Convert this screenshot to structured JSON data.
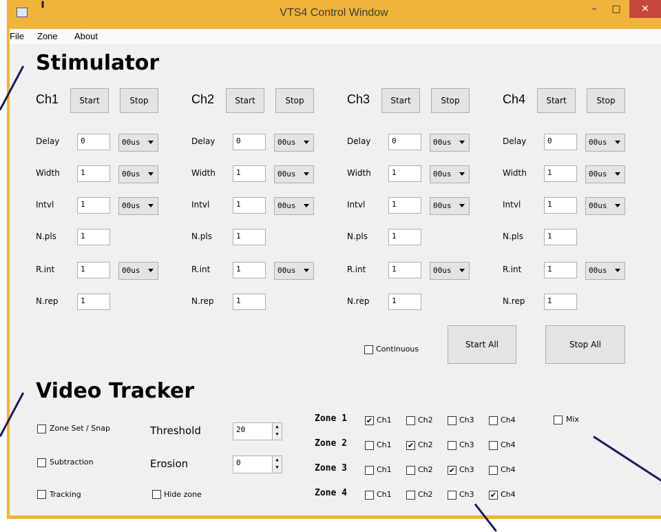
{
  "window": {
    "title": "VTS4 Control Window",
    "controls": {
      "minimize": "–",
      "maximize": "□",
      "close": "✕"
    },
    "accent": "#f0b43c"
  },
  "menu": [
    "File",
    "Zone",
    "About"
  ],
  "stimulator": {
    "heading": "Stimulator",
    "channels": [
      {
        "name": "Ch1",
        "start": "Start",
        "stop": "Stop",
        "labels": [
          "Delay",
          "Width",
          "Intvl",
          "N.pls",
          "R.int",
          "N.rep"
        ],
        "values": {
          "delay": "0",
          "width": "1",
          "intvl": "1",
          "npls": "1",
          "rint": "1",
          "nrep": "1"
        },
        "units": {
          "delay": "00us",
          "width": "00us",
          "intvl": "00us",
          "rint": "00us"
        }
      },
      {
        "name": "Ch2",
        "start": "Start",
        "stop": "Stop",
        "labels": [
          "Delay",
          "Width",
          "Intvl",
          "N.pls",
          "R.int",
          "N.rep"
        ],
        "values": {
          "delay": "0",
          "width": "1",
          "intvl": "1",
          "npls": "1",
          "rint": "1",
          "nrep": "1"
        },
        "units": {
          "delay": "00us",
          "width": "00us",
          "intvl": "00us",
          "rint": "00us"
        }
      },
      {
        "name": "Ch3",
        "start": "Start",
        "stop": "Stop",
        "labels": [
          "Delay",
          "Width",
          "Intvl",
          "N.pls",
          "R.int",
          "N.rep"
        ],
        "values": {
          "delay": "0",
          "width": "1",
          "intvl": "1",
          "npls": "1",
          "rint": "1",
          "nrep": "1"
        },
        "units": {
          "delay": "00us",
          "width": "00us",
          "intvl": "00us",
          "rint": "00us"
        }
      },
      {
        "name": "Ch4",
        "start": "Start",
        "stop": "Stop",
        "labels": [
          "Delay",
          "Width",
          "Intvl",
          "N.pls",
          "R.int",
          "N.rep"
        ],
        "values": {
          "delay": "0",
          "width": "1",
          "intvl": "1",
          "npls": "1",
          "rint": "1",
          "nrep": "1"
        },
        "units": {
          "delay": "00us",
          "width": "00us",
          "intvl": "00us",
          "rint": "00us"
        }
      }
    ],
    "continuous_label": "Continuous",
    "continuous_checked": false,
    "start_all": "Start All",
    "stop_all": "Stop All"
  },
  "video": {
    "heading": "Video Tracker",
    "zone_set_snap": "Zone Set / Snap",
    "subtraction": "Subtraction",
    "tracking": "Tracking",
    "hide_zone": "Hide zone",
    "threshold_label": "Threshold",
    "threshold_value": "20",
    "erosion_label": "Erosion",
    "erosion_value": "0",
    "mix_label": "Mix",
    "zones": [
      {
        "label": "Zone 1",
        "checks": [
          true,
          false,
          false,
          false
        ]
      },
      {
        "label": "Zone 2",
        "checks": [
          false,
          true,
          false,
          false
        ]
      },
      {
        "label": "Zone 3",
        "checks": [
          false,
          false,
          true,
          false
        ]
      },
      {
        "label": "Zone 4",
        "checks": [
          false,
          false,
          false,
          true
        ]
      }
    ],
    "channel_labels": [
      "Ch1",
      "Ch2",
      "Ch3",
      "Ch4"
    ]
  }
}
